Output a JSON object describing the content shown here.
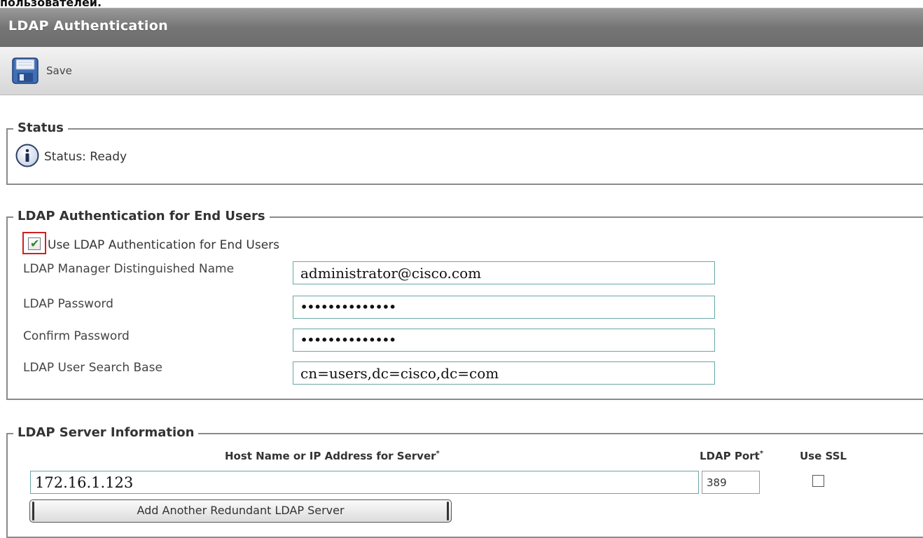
{
  "page": {
    "top_caption": "пользователей."
  },
  "header": {
    "title": "LDAP Authentication"
  },
  "toolbar": {
    "save_label": "Save",
    "save_icon": "floppy-disk-icon"
  },
  "status": {
    "legend": "Status",
    "text": "Status: Ready",
    "icon": "info-icon"
  },
  "ldap_auth": {
    "legend": "LDAP Authentication for End Users",
    "use_ldap_label": "Use LDAP Authentication for End Users",
    "use_ldap_checked": true,
    "fields": {
      "manager_dn": {
        "label": "LDAP Manager Distinguished Name",
        "value": "administrator@cisco.com"
      },
      "password": {
        "label": "LDAP Password",
        "value": "••••••••••••••"
      },
      "confirm_password": {
        "label": "Confirm Password",
        "value": "••••••••••••••"
      },
      "search_base": {
        "label": "LDAP User Search Base",
        "value": "cn=users,dc=cisco,dc=com"
      }
    }
  },
  "server_info": {
    "legend": "LDAP Server Information",
    "col_host": "Host Name or IP Address for Server",
    "col_port": "LDAP Port",
    "col_ssl": "Use SSL",
    "required_mark": "*",
    "host_value": "172.16.1.123",
    "port_value": "389",
    "use_ssl_checked": false,
    "add_server_label": "Add Another Redundant LDAP Server"
  }
}
